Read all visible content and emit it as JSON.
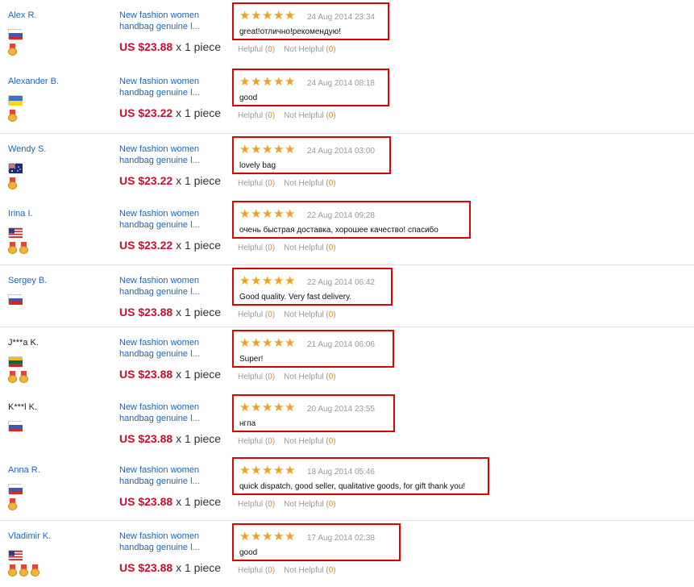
{
  "colors": {
    "link": "#2066b6",
    "price": "#c8102e",
    "star": "#f3a01a",
    "highlight_border": "#e00000",
    "vote_count": "#e8850c"
  },
  "labels": {
    "helpful": "Helpful",
    "not_helpful": "Not Helpful"
  },
  "reviews": [
    {
      "name": "Alex R.",
      "name_link": true,
      "country": "RU",
      "medals": 1,
      "product": "New fashion women handbag genuine l...",
      "price": "US $23.88",
      "qty": "x 1 piece",
      "stars": 5,
      "date": "24 Aug 2014 23:34",
      "text": "great!отлично!рекомендую!",
      "helpful": "0",
      "not_helpful": "0"
    },
    {
      "name": "Alexander B.",
      "name_link": true,
      "country": "UA",
      "medals": 1,
      "product": "New fashion women handbag genuine l...",
      "price": "US $23.22",
      "qty": "x 1 piece",
      "stars": 5,
      "date": "24 Aug 2014 08:18",
      "text": "good",
      "helpful": "0",
      "not_helpful": "0"
    },
    {
      "name": "Wendy S.",
      "name_link": true,
      "country": "AU",
      "medals": 1,
      "product": "New fashion women handbag genuine l...",
      "price": "US $23.22",
      "qty": "x 1 piece",
      "stars": 5,
      "date": "24 Aug 2014 03:00",
      "text": "lovely bag",
      "helpful": "0",
      "not_helpful": "0"
    },
    {
      "name": "Irina I.",
      "name_link": true,
      "country": "US",
      "medals": 2,
      "product": "New fashion women handbag genuine l...",
      "price": "US $23.22",
      "qty": "x 1 piece",
      "stars": 5,
      "date": "22 Aug 2014 09:28",
      "text": "очень быстрая доставка, хорошее качество! спасибо",
      "helpful": "0",
      "not_helpful": "0"
    },
    {
      "name": "Sergey B.",
      "name_link": true,
      "country": "RU",
      "medals": 0,
      "product": "New fashion women handbag genuine l...",
      "price": "US $23.88",
      "qty": "x 1 piece",
      "stars": 5,
      "date": "22 Aug 2014 06:42",
      "text": "Good quality. Very fast delivery.",
      "helpful": "0",
      "not_helpful": "0"
    },
    {
      "name": "J***a K.",
      "name_link": false,
      "country": "LT",
      "medals": 2,
      "product": "New fashion women handbag genuine l...",
      "price": "US $23.88",
      "qty": "x 1 piece",
      "stars": 5,
      "date": "21 Aug 2014 06:06",
      "text": "Super!",
      "helpful": "0",
      "not_helpful": "0"
    },
    {
      "name": "K***l K.",
      "name_link": false,
      "country": "RU",
      "medals": 0,
      "product": "New fashion women handbag genuine l...",
      "price": "US $23.88",
      "qty": "x 1 piece",
      "stars": 5,
      "date": "20 Aug 2014 23:55",
      "text": "нгпа",
      "helpful": "0",
      "not_helpful": "0"
    },
    {
      "name": "Anna R.",
      "name_link": true,
      "country": "RU",
      "medals": 1,
      "product": "New fashion women handbag genuine l...",
      "price": "US $23.88",
      "qty": "x 1 piece",
      "stars": 5,
      "date": "18 Aug 2014 05:46",
      "text": "quick dispatch, good seller, qualitative goods, for gift thank you!",
      "helpful": "0",
      "not_helpful": "0"
    },
    {
      "name": "Vladimir K.",
      "name_link": true,
      "country": "US",
      "medals": 3,
      "product": "New fashion women handbag genuine l...",
      "price": "US $23.88",
      "qty": "x 1 piece",
      "stars": 5,
      "date": "17 Aug 2014 02:38",
      "text": "good",
      "helpful": "0",
      "not_helpful": "0"
    }
  ]
}
